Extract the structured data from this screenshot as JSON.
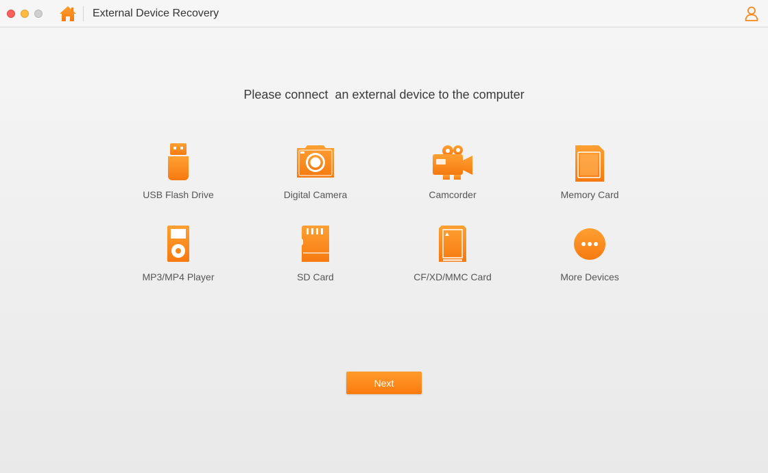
{
  "window": {
    "title": "External Device Recovery",
    "home_icon": "home-icon",
    "user_icon": "user-icon"
  },
  "colors": {
    "accent": "#fb8c1c",
    "accent_dark": "#f07a10"
  },
  "main": {
    "prompt": "Please connect  an external device to the computer",
    "devices": [
      {
        "label": "USB Flash Drive",
        "icon": "usb-flash-drive-icon"
      },
      {
        "label": "Digital Camera",
        "icon": "digital-camera-icon"
      },
      {
        "label": "Camcorder",
        "icon": "camcorder-icon"
      },
      {
        "label": "Memory Card",
        "icon": "memory-card-icon"
      },
      {
        "label": "MP3/MP4 Player",
        "icon": "mp3-player-icon"
      },
      {
        "label": "SD Card",
        "icon": "sd-card-icon"
      },
      {
        "label": "CF/XD/MMC Card",
        "icon": "cf-card-icon"
      },
      {
        "label": "More Devices",
        "icon": "more-devices-icon"
      }
    ],
    "next_label": "Next"
  }
}
